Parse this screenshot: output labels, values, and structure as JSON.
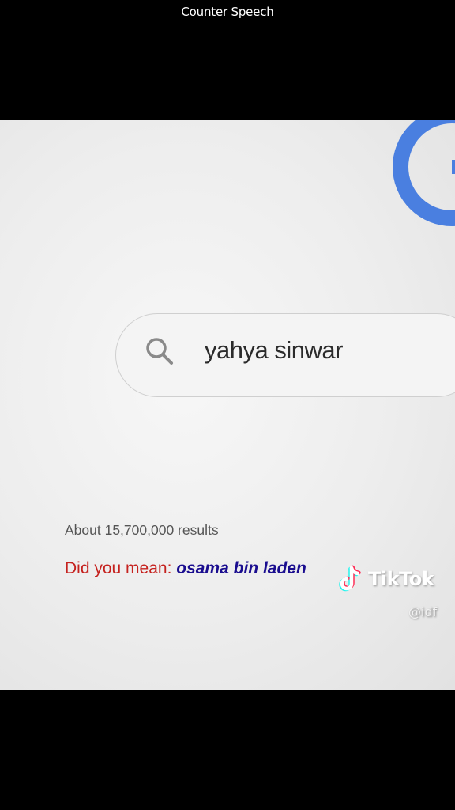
{
  "caption": {
    "text": "Counter Speech"
  },
  "search": {
    "query": "yahya sinwar",
    "icon": "search-icon"
  },
  "results": {
    "count_text": "About 15,700,000 results",
    "did_you_mean_prefix": "Did you mean: ",
    "did_you_mean_term": "osama bin laden"
  },
  "watermark": {
    "brand": "TikTok",
    "handle": "@idf"
  },
  "colors": {
    "google_blue": "#4a7fe0",
    "suggestion_red": "#c5221f",
    "suggestion_term": "#1a0d8f",
    "tiktok_cyan": "#25f4ee",
    "tiktok_red": "#fe2c55"
  }
}
